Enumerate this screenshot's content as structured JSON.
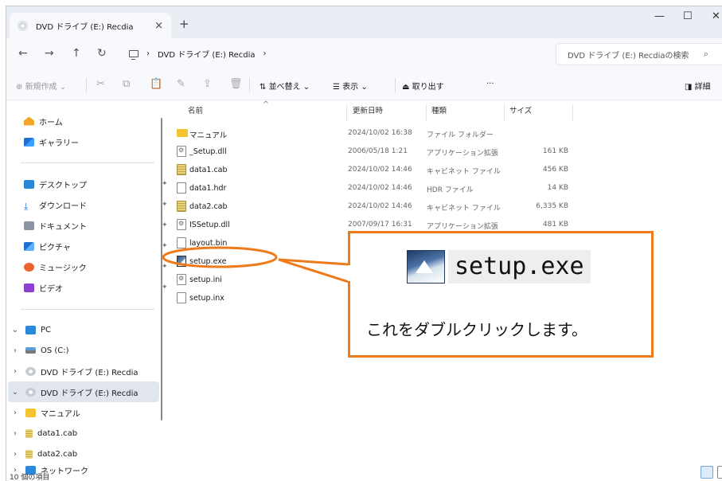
{
  "window": {
    "tab_title": "DVD ドライブ (E:) Recdia",
    "tab_close": "×",
    "new_tab": "+",
    "minimize": "—",
    "maximize": "☐",
    "close": "✕"
  },
  "address": {
    "crumb_1": "DVD ドライブ (E:) Recdia",
    "search_placeholder": "DVD ドライブ (E:) Recdiaの検索"
  },
  "toolbar": {
    "new": "新規作成",
    "sort": "並べ替え",
    "view": "表示",
    "eject": "取り出す",
    "more": "···",
    "details": "詳細"
  },
  "sidebar": {
    "home": "ホーム",
    "gallery": "ギャラリー",
    "desktop": "デスクトップ",
    "downloads": "ダウンロード",
    "documents": "ドキュメント",
    "pictures": "ピクチャ",
    "music": "ミュージック",
    "videos": "ビデオ",
    "pc": "PC",
    "os": "OS (C:)",
    "dvd1": "DVD ドライブ (E:) Recdia",
    "dvd2": "DVD ドライブ (E:) Recdia",
    "manual": "マニュアル",
    "data1": "data1.cab",
    "data2": "data2.cab",
    "network": "ネットワーク"
  },
  "columns": {
    "name": "名前",
    "date": "更新日時",
    "type": "種類",
    "size": "サイズ"
  },
  "files": [
    {
      "name": "マニュアル",
      "date": "2024/10/02 16:38",
      "type": "ファイル フォルダー",
      "size": "",
      "icon": "folder"
    },
    {
      "name": "_Setup.dll",
      "date": "2006/05/18 1:21",
      "type": "アプリケーション拡張",
      "size": "161 KB",
      "icon": "dll"
    },
    {
      "name": "data1.cab",
      "date": "2024/10/02 14:46",
      "type": "キャビネット ファイル",
      "size": "456 KB",
      "icon": "cab"
    },
    {
      "name": "data1.hdr",
      "date": "2024/10/02 14:46",
      "type": "HDR ファイル",
      "size": "14 KB",
      "icon": "doc"
    },
    {
      "name": "data2.cab",
      "date": "2024/10/02 14:46",
      "type": "キャビネット ファイル",
      "size": "6,335 KB",
      "icon": "cab"
    },
    {
      "name": "ISSetup.dll",
      "date": "2007/09/17 16:31",
      "type": "アプリケーション拡張",
      "size": "481 KB",
      "icon": "dll"
    },
    {
      "name": "layout.bin",
      "date": "",
      "type": "",
      "size": "",
      "icon": "doc"
    },
    {
      "name": "setup.exe",
      "date": "",
      "type": "",
      "size": "",
      "icon": "exe"
    },
    {
      "name": "setup.ini",
      "date": "",
      "type": "",
      "size": "",
      "icon": "dll"
    },
    {
      "name": "setup.inx",
      "date": "",
      "type": "",
      "size": "",
      "icon": "doc"
    }
  ],
  "status": "10 個の項目",
  "annotation": {
    "exe_name": "setup.exe",
    "instruction": "これをダブルクリックします。",
    "color": "#ef7a1a"
  }
}
